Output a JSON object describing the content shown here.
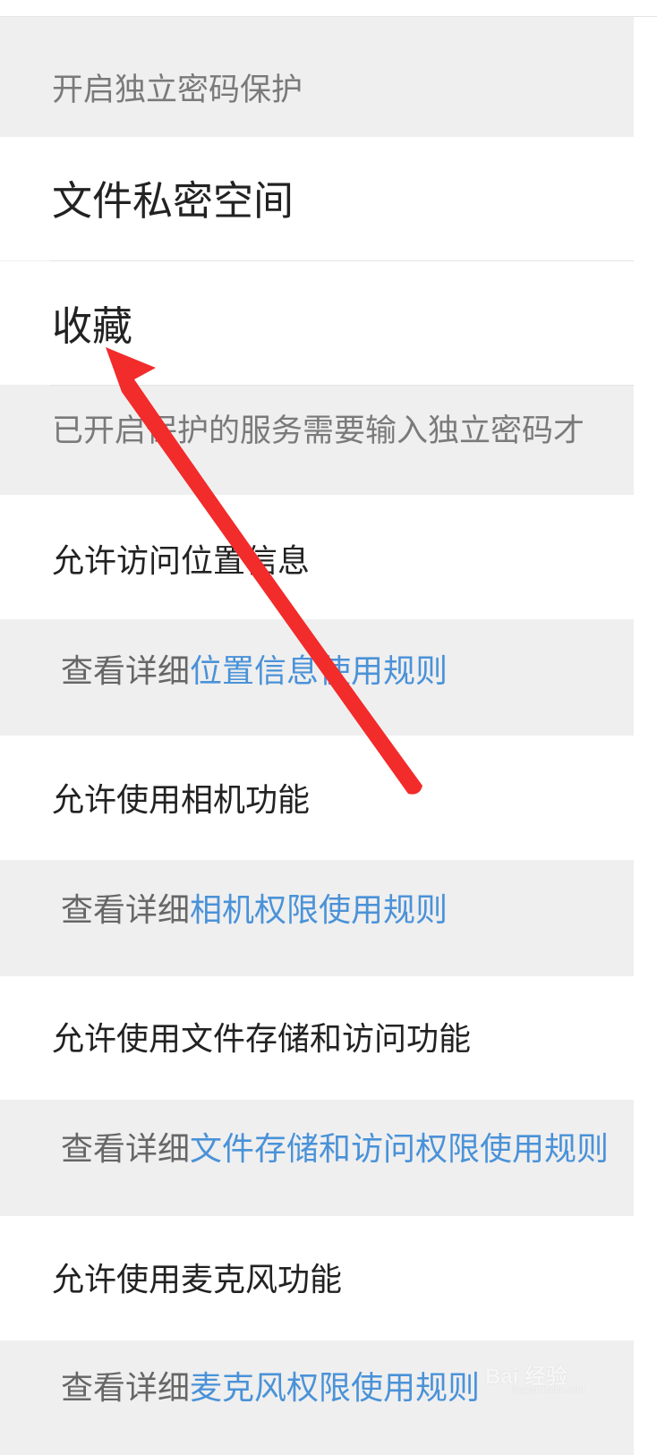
{
  "header": {
    "title": "开启独立密码保护"
  },
  "protected_items": [
    {
      "label": "文件私密空间"
    },
    {
      "label": "收藏"
    }
  ],
  "note": {
    "text": "已开启保护的服务需要输入独立密码才"
  },
  "permissions": [
    {
      "label": "允许访问位置信息",
      "detail_prefix": "查看详细",
      "detail_link": "位置信息使用规则"
    },
    {
      "label": "允许使用相机功能",
      "detail_prefix": "查看详细",
      "detail_link": "相机权限使用规则"
    },
    {
      "label": "允许使用文件存储和访问功能",
      "detail_prefix": "查看详细",
      "detail_link": "文件存储和访问权限使用规则"
    },
    {
      "label": "允许使用麦克风功能",
      "detail_prefix": "查看详细",
      "detail_link": "麦克风权限使用规则"
    }
  ],
  "watermark": {
    "text": "Bai 经验",
    "sub": "jingyan.baidu.com"
  },
  "colors": {
    "link": "#4a92d8",
    "annotation_arrow": "#f22b2b",
    "section_bg": "#efefef",
    "row_bg": "#ffffff"
  },
  "annotation": {
    "icon": "red-arrow-icon",
    "target": "收藏"
  }
}
